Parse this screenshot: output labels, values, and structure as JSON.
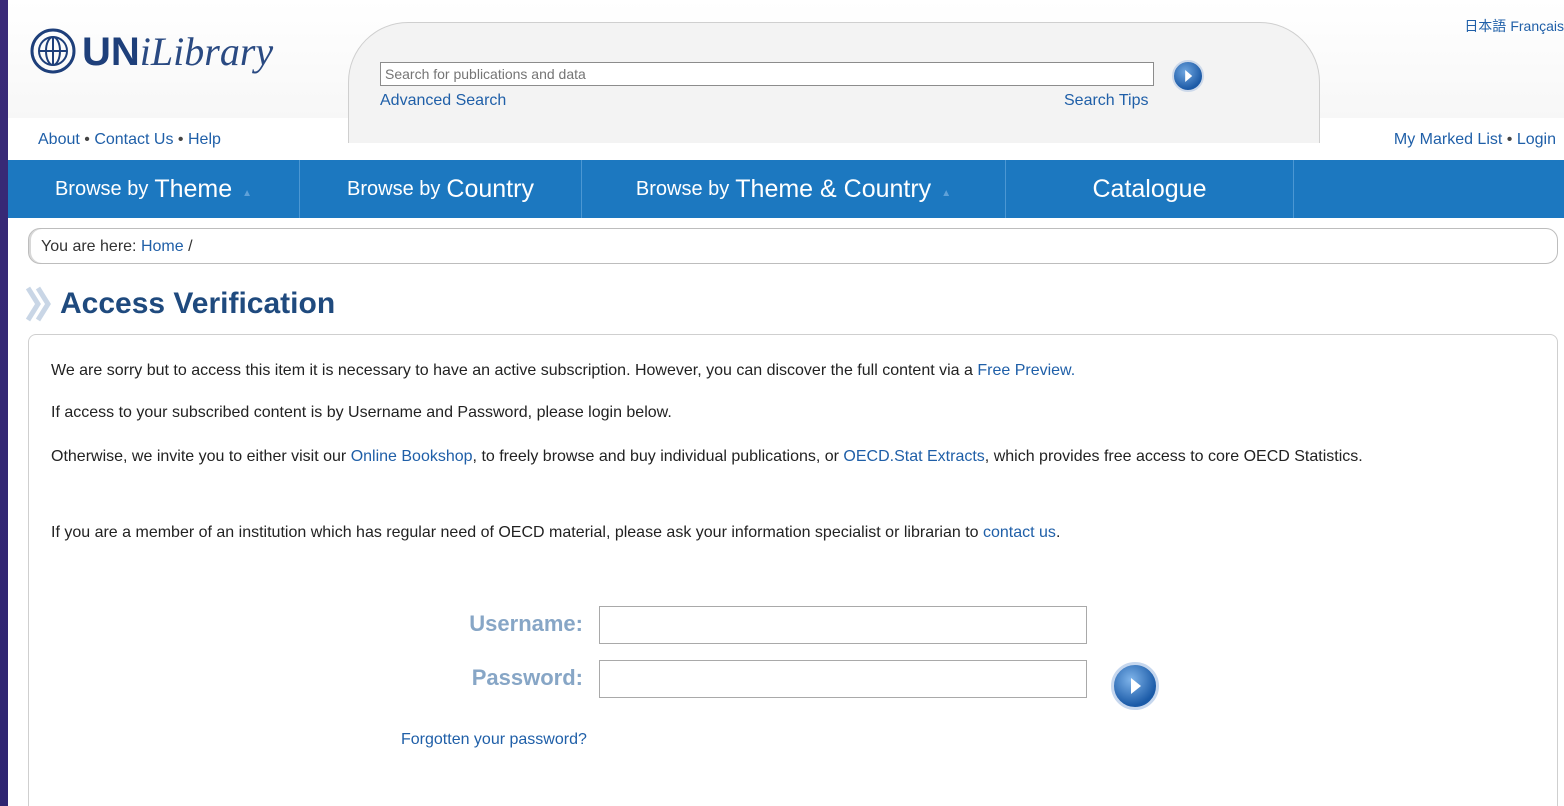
{
  "header": {
    "logo": {
      "un": "UN",
      "ilibrary": "iLibrary"
    },
    "languages": [
      "日本語",
      "Français"
    ],
    "search": {
      "placeholder": "Search for publications and data",
      "advanced_label": "Advanced Search",
      "tips_label": "Search Tips"
    },
    "top_links_left": [
      "About",
      "Contact Us",
      "Help"
    ],
    "top_links_right": [
      "My Marked List",
      "Login"
    ],
    "separator": "•"
  },
  "nav": {
    "items": [
      {
        "prefix": "Browse by",
        "main": "Theme"
      },
      {
        "prefix": "Browse by",
        "main": "Country"
      },
      {
        "prefix": "Browse by",
        "main": "Theme & Country"
      },
      {
        "prefix": "",
        "main": "Catalogue"
      }
    ]
  },
  "breadcrumb": {
    "prefix": "You are here:",
    "home": "Home",
    "sep": "/"
  },
  "page_title": "Access Verification",
  "content": {
    "p1_text": "We are sorry but to access this item it is necessary to have an active subscription. However,  you can discover the full content via a ",
    "p1_link": "Free Preview.",
    "p2_text": "If access to your subscribed content is by Username and Password, please login below.",
    "p3_text_a": "Otherwise, we invite you to either visit our ",
    "p3_link_a": "Online Bookshop",
    "p3_text_b": ", to freely browse and buy individual publications, or ",
    "p3_link_b": "OECD.Stat Extracts",
    "p3_text_c": ", which provides free access to core OECD Statistics.",
    "p4_text": "If you are a member of an institution which has regular need of OECD material, please ask your information specialist or librarian to ",
    "p4_link": "contact us",
    "p4_end": "."
  },
  "login": {
    "username_label": "Username:",
    "password_label": "Password:",
    "username_value": "",
    "password_value": "",
    "forgot_label": "Forgotten your password?"
  },
  "colors": {
    "nav_bg": "#1c78c0",
    "link": "#1f5fa8",
    "title": "#1f4a7e",
    "label": "#87a6c6"
  }
}
